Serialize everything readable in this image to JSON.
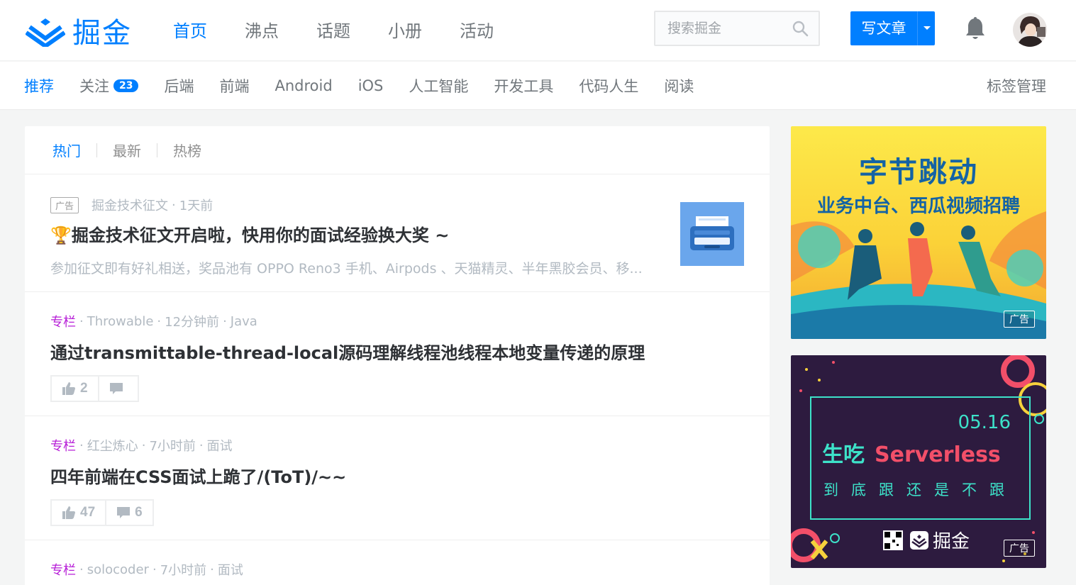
{
  "header": {
    "logo_text": "掘金",
    "nav": [
      {
        "label": "首页",
        "active": true
      },
      {
        "label": "沸点",
        "active": false
      },
      {
        "label": "话题",
        "active": false
      },
      {
        "label": "小册",
        "active": false
      },
      {
        "label": "活动",
        "active": false
      }
    ],
    "search_placeholder": "搜索掘金",
    "write_label": "写文章"
  },
  "subnav": {
    "items": [
      {
        "label": "推荐",
        "active": true
      },
      {
        "label": "关注",
        "badge": "23"
      },
      {
        "label": "后端"
      },
      {
        "label": "前端"
      },
      {
        "label": "Android"
      },
      {
        "label": "iOS"
      },
      {
        "label": "人工智能"
      },
      {
        "label": "开发工具"
      },
      {
        "label": "代码人生"
      },
      {
        "label": "阅读"
      }
    ],
    "tag_manage": "标签管理"
  },
  "feed": {
    "tabs": [
      "热门",
      "最新",
      "热榜"
    ],
    "entries": [
      {
        "ad_tag": "广告",
        "author": "掘金技术征文",
        "time": "1天前",
        "title": "🏆掘金技术征文开启啦，快用你的面试经验换大奖 ~",
        "abstract": "参加征文即有好礼相送，奖品池有 OPPO Reno3 手机、Airpods 、天猫精灵、半年黑胶会员、移..."
      },
      {
        "column": "专栏",
        "author": "Throwable",
        "time": "12分钟前",
        "tag": "Java",
        "title": "通过transmittable-thread-local源码理解线程池线程本地变量传递的原理",
        "likes": "2",
        "comments": ""
      },
      {
        "column": "专栏",
        "author": "红尘炼心",
        "time": "7小时前",
        "tag": "面试",
        "title": "四年前端在CSS面试上跪了/(ToT)/~~",
        "likes": "47",
        "comments": "6"
      },
      {
        "column": "专栏",
        "author": "solocoder",
        "time": "7小时前",
        "tag": "面试"
      }
    ]
  },
  "ads": {
    "ad1": {
      "title": "字节跳动",
      "subtitle": "业务中台、西瓜视频招聘",
      "label": "广告"
    },
    "ad2": {
      "date": "05.16",
      "title_a": "生吃",
      "title_b": "Serverless",
      "sub": "到底跟还是不跟",
      "brand": "掘金",
      "label": "广告"
    }
  },
  "colors": {
    "accent": "#007fff",
    "column": "#b71ed7"
  }
}
